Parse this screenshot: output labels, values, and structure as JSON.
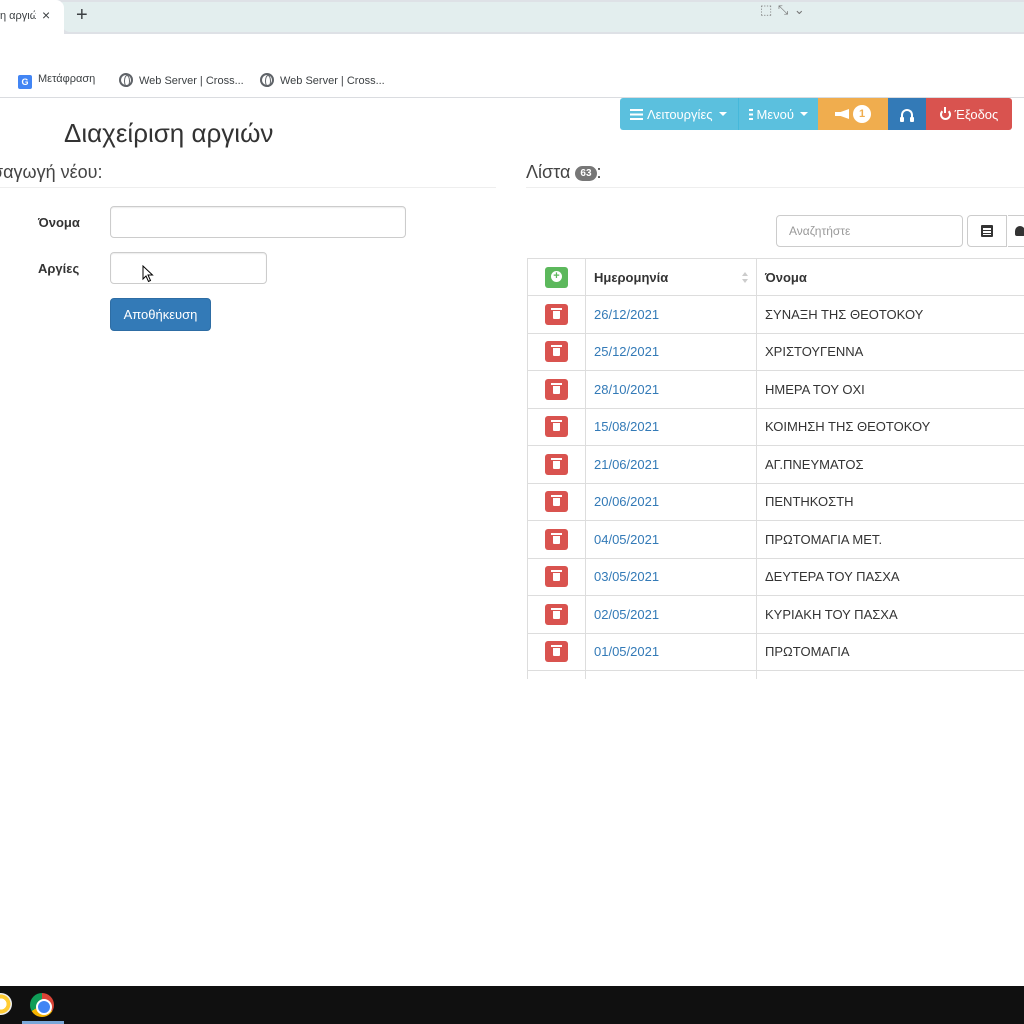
{
  "browser": {
    "tab_title": "η αργιώ",
    "tab_close": "×",
    "new_tab": "+",
    "window_controls": "⬚ ⤡ ⌄",
    "bookmarks": [
      {
        "label": "Μετάφραση",
        "icon": "translate-icon"
      },
      {
        "label": "Web Server | Cross...",
        "icon": "globe-icon"
      },
      {
        "label": "Web Server | Cross...",
        "icon": "globe-icon"
      }
    ]
  },
  "nav": {
    "functions_label": "Λειτουργίες",
    "menu_label": "Μενού",
    "notifications_count": "1",
    "exit_label": "Έξοδος"
  },
  "page": {
    "title": "Διαχείριση αργιών",
    "new_section_title": "ισαγωγή νέου:",
    "list_section_title": "Λίστα",
    "list_count": "63",
    "list_suffix": ":"
  },
  "form": {
    "name_label": "Όνομα",
    "name_value": "",
    "holidays_label": "Αργίες",
    "holidays_value": "",
    "save_label": "Αποθήκευση"
  },
  "table": {
    "search_placeholder": "Αναζητήστε",
    "columns": [
      "",
      "Ημερομηνία",
      "Όνομα"
    ],
    "rows": [
      {
        "date": "26/12/2021",
        "name": "ΣΥΝΑΞΗ ΤΗΣ ΘΕΟΤΟΚΟΥ"
      },
      {
        "date": "25/12/2021",
        "name": "ΧΡΙΣΤΟΥΓΕΝΝΑ"
      },
      {
        "date": "28/10/2021",
        "name": "ΗΜΕΡΑ ΤΟΥ ΟΧΙ"
      },
      {
        "date": "15/08/2021",
        "name": "ΚΟΙΜΗΣΗ ΤΗΣ ΘΕΟΤΟΚΟΥ"
      },
      {
        "date": "21/06/2021",
        "name": "ΑΓ.ΠΝΕΥΜΑΤΟΣ"
      },
      {
        "date": "20/06/2021",
        "name": "ΠΕΝΤΗΚΟΣΤΗ"
      },
      {
        "date": "04/05/2021",
        "name": "ΠΡΩΤΟΜΑΓΙΑ ΜΕΤ."
      },
      {
        "date": "03/05/2021",
        "name": "ΔΕΥΤΕΡΑ ΤΟΥ ΠΑΣΧΑ"
      },
      {
        "date": "02/05/2021",
        "name": "ΚΥΡΙΑΚΗ ΤΟΥ ΠΑΣΧΑ"
      },
      {
        "date": "01/05/2021",
        "name": "ΠΡΩΤΟΜΑΓΙΑ"
      },
      {
        "date": "",
        "name": ""
      }
    ]
  },
  "colors": {
    "info": "#5bc0de",
    "warning": "#f0ad4e",
    "primary": "#337ab7",
    "danger": "#d9534f",
    "success": "#5cb85c"
  }
}
